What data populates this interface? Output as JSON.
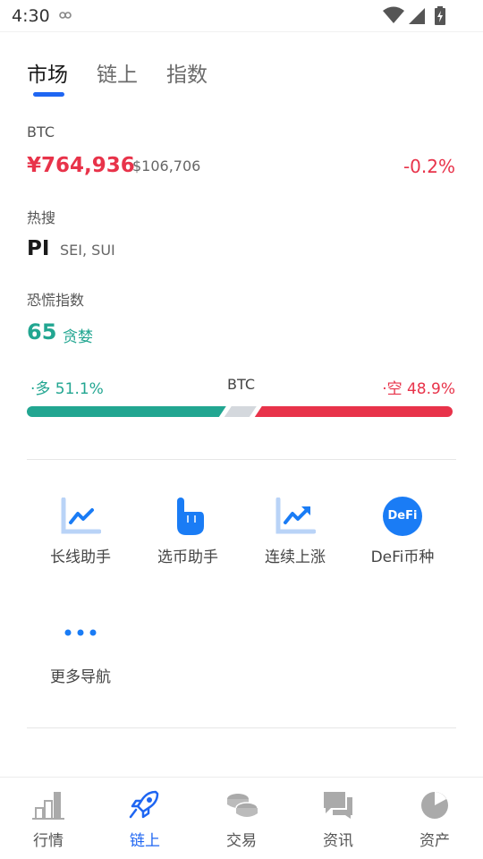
{
  "status_bar": {
    "time": "4:30"
  },
  "tabs": [
    {
      "label": "市场",
      "active": true
    },
    {
      "label": "链上",
      "active": false
    },
    {
      "label": "指数",
      "active": false
    }
  ],
  "btc": {
    "label": "BTC",
    "price_cny": "¥764,936",
    "price_usd": "$106,706",
    "change": "-0.2%"
  },
  "hot_search": {
    "label": "热搜",
    "top": "PI",
    "others": "SEI, SUI"
  },
  "fear_index": {
    "label": "恐慌指数",
    "value": "65",
    "sentiment": "贪婪"
  },
  "long_short": {
    "long_label": "·多 51.1%",
    "asset": "BTC",
    "short_label": "·空 48.9%",
    "long_ratio": 0.511,
    "short_ratio": 0.489
  },
  "quick_nav": [
    {
      "label": "长线助手",
      "icon": "long-term-chart-icon"
    },
    {
      "label": "选币助手",
      "icon": "pointing-hand-icon"
    },
    {
      "label": "连续上涨",
      "icon": "trend-up-chart-icon"
    },
    {
      "label": "DeFi币种",
      "icon": "defi-icon",
      "badge": "DeFi"
    },
    {
      "label": "更多导航",
      "icon": "more-dots-icon"
    }
  ],
  "bottom_nav": [
    {
      "label": "行情",
      "icon": "bar-chart-icon",
      "active": false
    },
    {
      "label": "链上",
      "icon": "rocket-icon",
      "active": true
    },
    {
      "label": "交易",
      "icon": "coins-icon",
      "active": false
    },
    {
      "label": "资讯",
      "icon": "chat-bubbles-icon",
      "active": false
    },
    {
      "label": "资产",
      "icon": "pie-chart-icon",
      "active": false
    }
  ],
  "colors": {
    "accent": "#1f66f2",
    "up": "#22a691",
    "down": "#e8334a",
    "icon_blue": "#1a7cf5"
  }
}
